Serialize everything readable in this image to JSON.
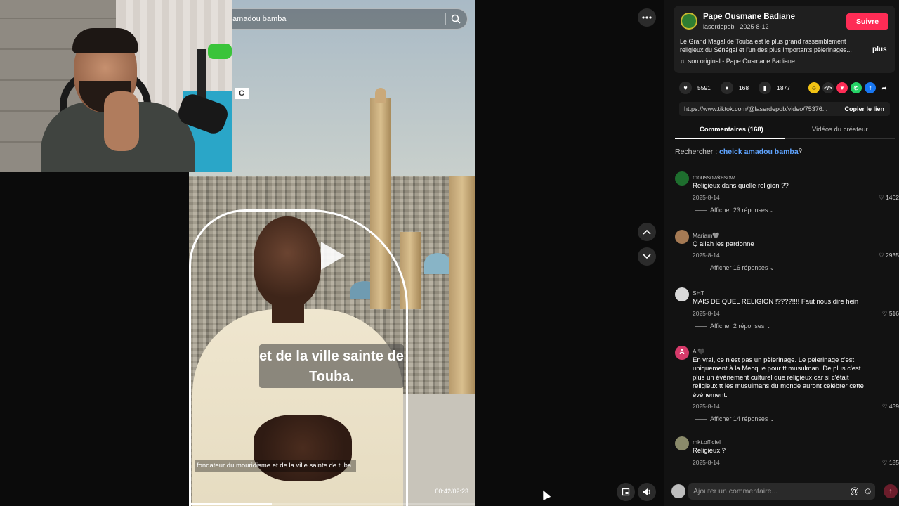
{
  "video": {
    "search_query": "amadou bamba",
    "cc_label": "C",
    "caption": "et de la ville sainte de Touba.",
    "subtitle": "fondateur du mouridisme et de la ville sainte de tuba",
    "time": "00:42/02:23",
    "progress": 0.29
  },
  "author": {
    "name": "Pape Ousmane Badiane",
    "meta": "laserdepob · 2025-8-12",
    "follow_label": "Suivre",
    "description": "Le Grand Magal de Touba est le plus grand rassemblement religieux du Sénégal et l'un des plus importants pèlerinages...",
    "more_label": "plus",
    "music_icon": "♫",
    "music": "son original - Pape Ousmane Badiane"
  },
  "stats": {
    "likes": "5591",
    "comments": "168",
    "saves": "1877"
  },
  "share_icons": [
    {
      "name": "emoji-share-icon",
      "glyph": "☺",
      "color": "#f2c314"
    },
    {
      "name": "embed-icon",
      "glyph": "</>",
      "color": "#2a2a2a"
    },
    {
      "name": "send-share-icon",
      "glyph": "▼",
      "color": "#fe2c55"
    },
    {
      "name": "whatsapp-icon",
      "glyph": "✆",
      "color": "#25d366"
    },
    {
      "name": "facebook-icon",
      "glyph": "f",
      "color": "#1877f2"
    },
    {
      "name": "forward-share-icon",
      "glyph": "➦",
      "color": "#121212"
    }
  ],
  "link": {
    "url": "https://www.tiktok.com/@laserdepob/video/75376...",
    "copy_label": "Copier le lien"
  },
  "tabs": {
    "comments": "Commentaires (168)",
    "creator": "Vidéos du créateur"
  },
  "search": {
    "prefix": "Rechercher :",
    "term": "cheick amadou bamba"
  },
  "comments": [
    {
      "user": "moussowkasow",
      "text": "Religieux dans quelle religion ??",
      "date": "2025-8-14",
      "likes": "1462",
      "replies": "Afficher 23 réponses",
      "avatar_color": "#1e6e2e"
    },
    {
      "user": "Mariam🩶",
      "text": "Q allah les pardonne",
      "date": "2025-8-14",
      "likes": "2935",
      "replies": "Afficher 16 réponses",
      "avatar_color": "#a57a54"
    },
    {
      "user": "SHT",
      "text": "MAIS DE QUEL RELIGION !????!!!! Faut nous dire hein",
      "date": "2025-8-14",
      "likes": "516",
      "replies": "Afficher 2 réponses",
      "avatar_color": "#d8d8d8"
    },
    {
      "user": "A'🖤",
      "text": "En vrai, ce n'est pas un pèlerinage. Le pèlerinage c'est uniquement à la Mecque pour tt musulman. De plus c'est plus un événement culturel que religieux car si c'était religieux tt les musulmans du monde auront célébrer cette événement.",
      "date": "2025-8-14",
      "likes": "439",
      "replies": "Afficher 14 réponses",
      "avatar_color": "#d63a6a",
      "avatar_letter": "A"
    },
    {
      "user": "mkt.officiel",
      "text": "Religieux ?",
      "date": "2025-8-14",
      "likes": "185",
      "replies": "",
      "avatar_color": "#8a8a6a"
    }
  ],
  "composer": {
    "placeholder": "Ajouter un commentaire..."
  }
}
